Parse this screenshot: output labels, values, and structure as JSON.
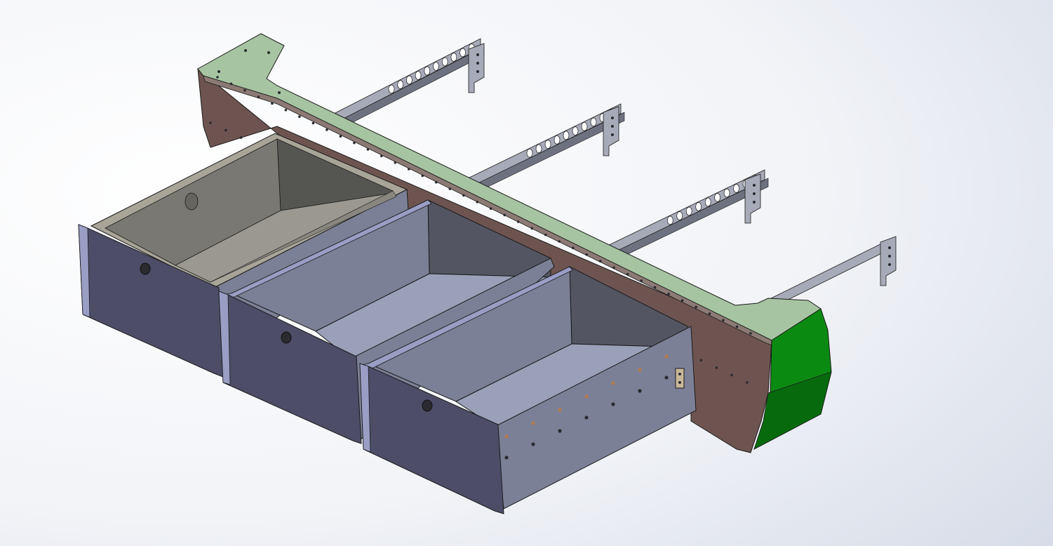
{
  "colors": {
    "background_light": "#ffffff",
    "background_dark": "#d8dde8",
    "panel_top": "#a6c4a1",
    "panel_side": "#6e5450",
    "panel_edge": "#4a3633",
    "end_cap": "#0b8a12",
    "end_cap_dark": "#076b0d",
    "drawer_front": "#4d4d68",
    "drawer_front_edge": "#9a9dc4",
    "drawer_side": "#7c8096",
    "drawer_inner_back": "#535563",
    "drawer_floor": "#9aa0b8",
    "tray_rim": "#a8a598",
    "tray_inner": "#7a7872",
    "tray_inner_dark": "#555552",
    "tray_floor": "#9a9890",
    "rail": "#a7aab8",
    "rail_dark": "#6e7180",
    "hole": "#2a2a30",
    "bolt": "#b07a50",
    "outline": "#1a1a1a"
  },
  "parts": {
    "top_panel": "top-panel",
    "back_wall": "back-wall",
    "end_cap": "end-cap",
    "drawers": [
      "drawer-1",
      "drawer-2",
      "drawer-3"
    ],
    "rails": [
      "rail-1",
      "rail-2",
      "rail-3",
      "rail-4"
    ],
    "icons": {
      "handle": "handle-hole-icon",
      "mount_hole": "mount-hole-icon",
      "bolt": "bolt-icon"
    }
  }
}
